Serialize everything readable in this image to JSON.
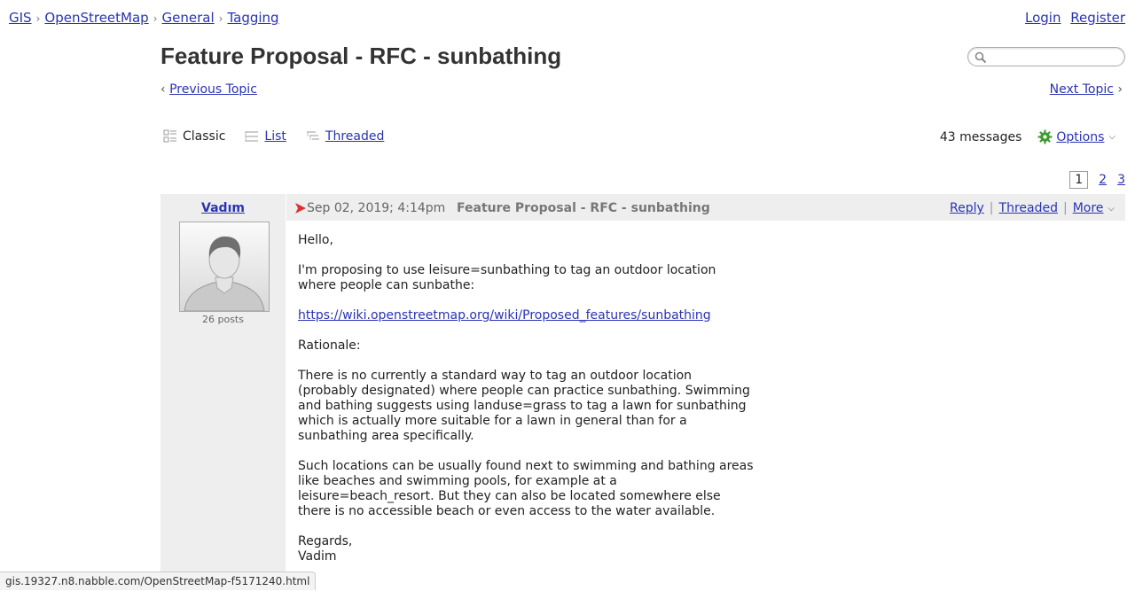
{
  "breadcrumb": [
    "GIS",
    "OpenStreetMap",
    "General",
    "Tagging"
  ],
  "breadcrumb_separator": "›",
  "auth": {
    "login": "Login",
    "register": "Register"
  },
  "topic": {
    "title": "Feature Proposal - RFC - sunbathing"
  },
  "search": {
    "placeholder": "",
    "value": ""
  },
  "nav": {
    "previous": "Previous Topic",
    "next": "Next Topic"
  },
  "views": {
    "classic": "Classic",
    "list": "List",
    "threaded": "Threaded"
  },
  "meta": {
    "message_count": "43 messages",
    "options": "Options"
  },
  "pagination": {
    "current": "1",
    "pages": [
      "2",
      "3"
    ]
  },
  "post": {
    "author": "Vadım",
    "posts_count": "26 posts",
    "date": "Sep 02, 2019; 4:14pm",
    "subject": "Feature Proposal - RFC - sunbathing",
    "actions": {
      "reply": "Reply",
      "threaded": "Threaded",
      "more": "More"
    },
    "body": {
      "greeting": "Hello,",
      "intro": "I'm proposing to use leisure=sunbathing to tag an outdoor location\nwhere people can sunbathe:",
      "link": "https://wiki.openstreetmap.org/wiki/Proposed_features/sunbathing",
      "rationale_heading": "Rationale:",
      "rationale_1": "There is no currently a standard way to tag an outdoor location\n(probably designated) where people can practice sunbathing. Swimming\nand bathing suggests using landuse=grass to tag a lawn for sunbathing\nwhich is actually more suitable for a lawn in general than for a\nsunbathing area specifically.",
      "rationale_2": "Such locations can be usually found next to swimming and bathing areas\nlike beaches and swimming pools, for example at a\nleisure=beach_resort. But they can also be located somewhere else\nthere is no accessible beach or even access to the water available.",
      "signoff": "Regards,\nVadim"
    }
  },
  "status_bar": "gis.19327.n8.nabble.com/OpenStreetMap-f5171240.html",
  "colors": {
    "link": "#2a33b3",
    "panel": "#eeeeee",
    "flag": "#e03030",
    "gear": "#3f9a2f"
  }
}
